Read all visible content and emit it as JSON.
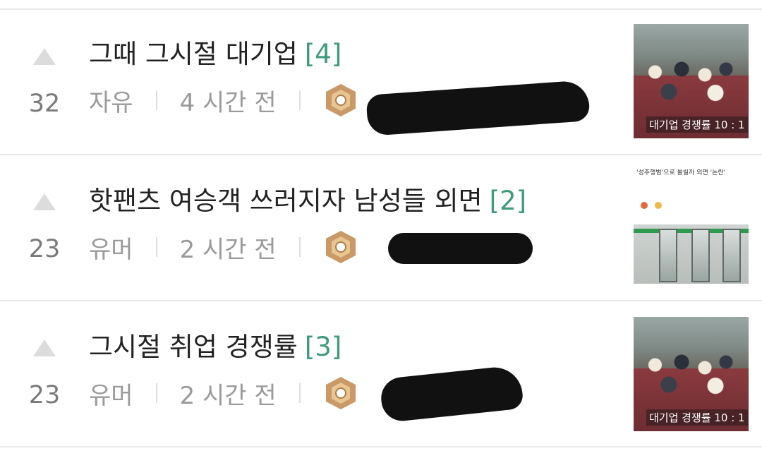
{
  "posts": [
    {
      "votes": "32",
      "title": "그때 그시절 대기업",
      "comments": "[4]",
      "board": "자유",
      "time": "4 시간 전",
      "thumb_caption": "대기업 경쟁률 10 : 1"
    },
    {
      "votes": "23",
      "title": "핫팬츠 여승객 쓰러지자 남성들 외면",
      "comments": "[2]",
      "board": "유머",
      "time": "2 시간 전",
      "thumb_caption": "'성추행범'으로 몰릴까 외면 '논란'"
    },
    {
      "votes": "23",
      "title": "그시절 취업 경쟁률",
      "comments": "[3]",
      "board": "유머",
      "time": "2 시간 전",
      "thumb_caption": "대기업 경쟁률 10 : 1"
    }
  ],
  "colors": {
    "comment_count": "#3f9a7c",
    "vote_arrow": "#dcdcdc",
    "meta_text": "#9a9a9a",
    "badge": "#c99a67"
  },
  "icons": {
    "vote": "upvote-arrow-icon",
    "badge": "level-badge-icon"
  }
}
